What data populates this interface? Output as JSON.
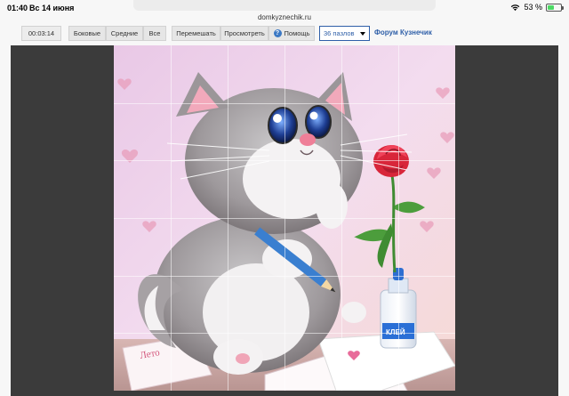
{
  "status": {
    "time": "01:40",
    "date": "Вс 14 июня",
    "battery": "53 %",
    "battery_level": 0.53
  },
  "browser": {
    "url": "domkyznechik.ru"
  },
  "toolbar": {
    "timer": "00:03:14",
    "buttons": [
      {
        "label": "Боковые"
      },
      {
        "label": "Средние"
      },
      {
        "label": "Все"
      },
      {
        "label": "Перемешать"
      },
      {
        "label": "Просмотреть"
      },
      {
        "label": "Помощь"
      }
    ],
    "pieces_select": "36 пазлов",
    "forum_link": "Форум Кузнечик"
  },
  "puzzle": {
    "rows": 6,
    "cols": 6,
    "image_text": [
      "Лето",
      "КЛЕЙ"
    ]
  },
  "colors": {
    "accent": "#2f5fa8",
    "board": "#3b3b3b",
    "background": "#f7f7f7"
  }
}
